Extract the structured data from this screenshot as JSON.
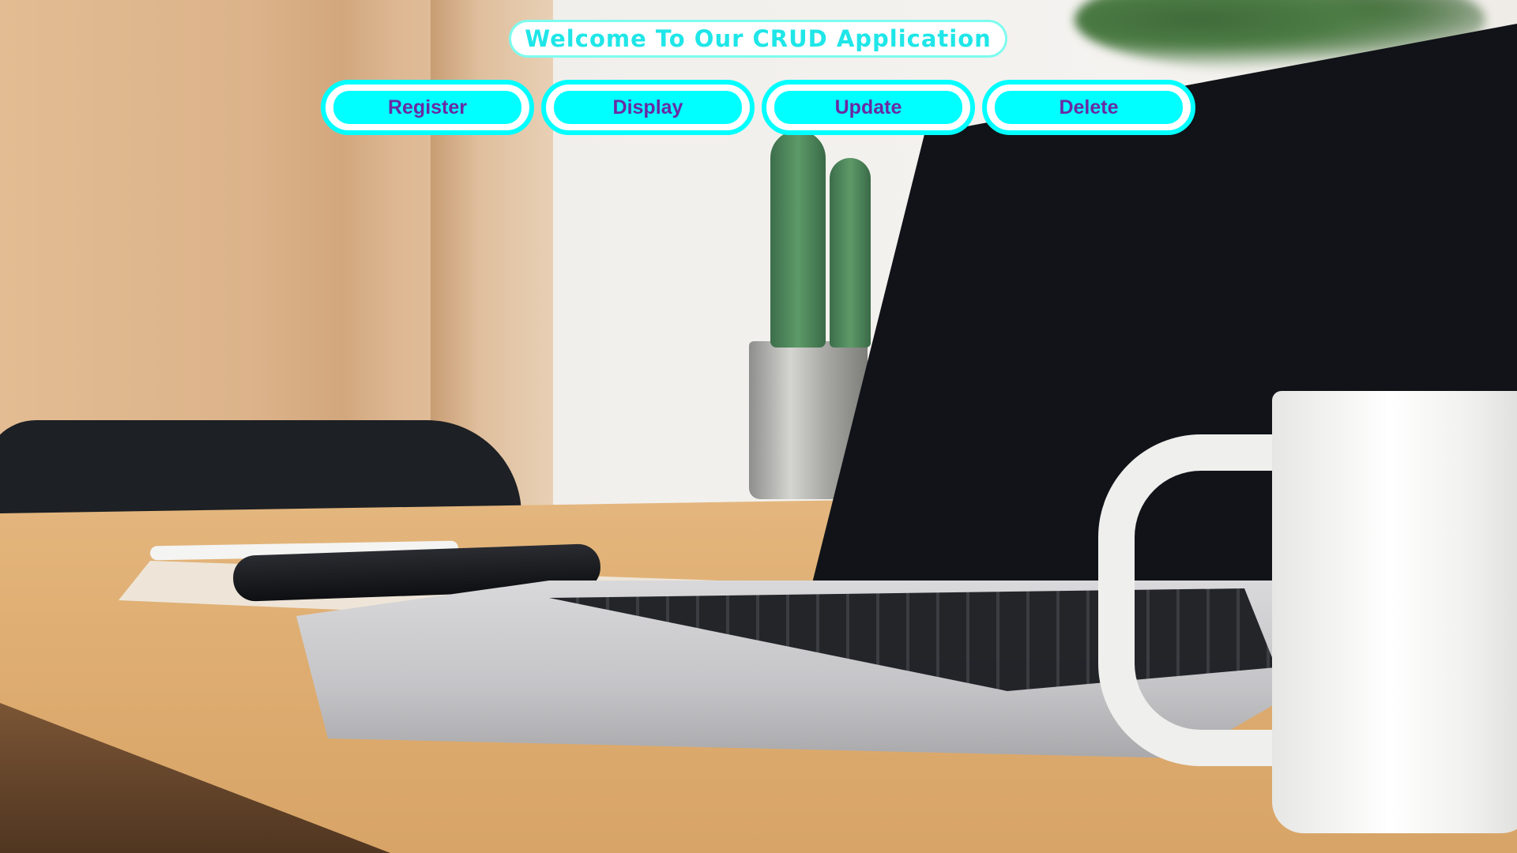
{
  "header": {
    "title": "Welcome To Our CRUD Application"
  },
  "nav": {
    "buttons": [
      {
        "label": "Register"
      },
      {
        "label": "Display"
      },
      {
        "label": "Update"
      },
      {
        "label": "Delete"
      }
    ]
  },
  "colors": {
    "accent": "#00ffff",
    "button_text": "#6a2aa3",
    "title_text": "#1fe6e8"
  },
  "background": {
    "icon": "desk-laptop-photo"
  }
}
